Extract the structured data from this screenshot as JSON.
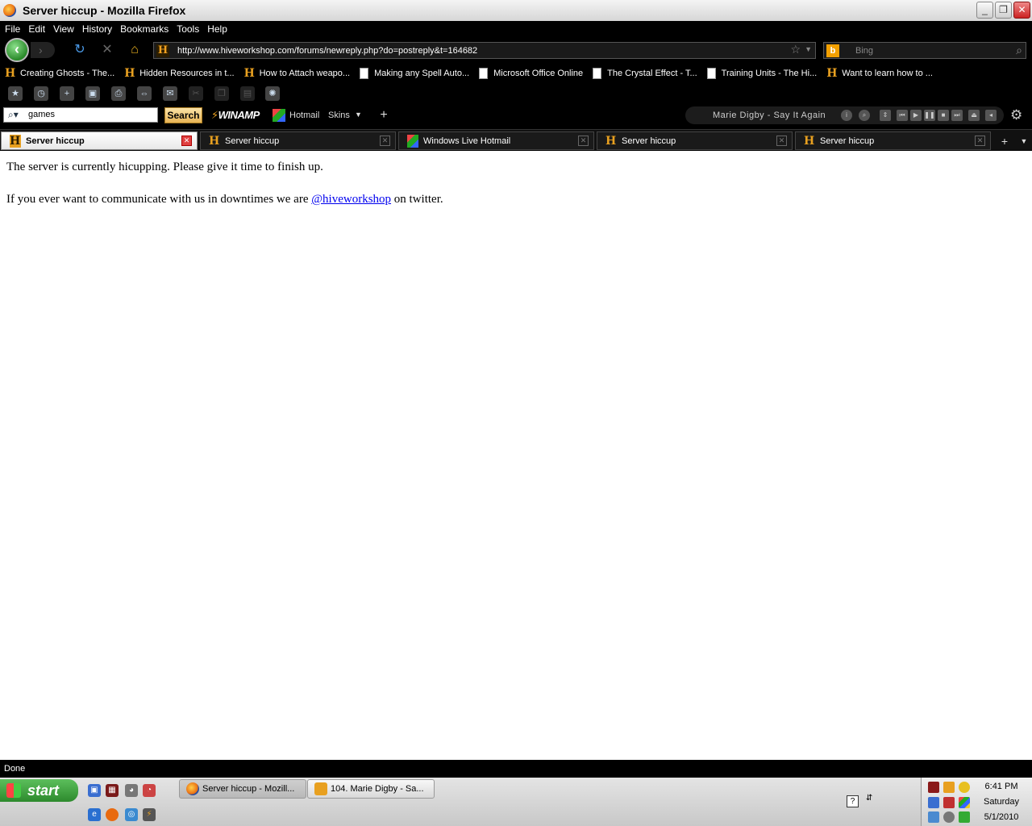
{
  "window": {
    "title": "Server hiccup - Mozilla Firefox",
    "buttons": [
      "minimize",
      "restore",
      "close"
    ]
  },
  "menu": [
    "File",
    "Edit",
    "View",
    "History",
    "Bookmarks",
    "Tools",
    "Help"
  ],
  "nav": {
    "url": "http://www.hiveworkshop.com/forums/newreply.php?do=postreply&t=164682",
    "search_placeholder": "Bing"
  },
  "bookmarks": [
    {
      "label": "Creating Ghosts - The...",
      "icon": "hive-icon"
    },
    {
      "label": "Hidden Resources in t...",
      "icon": "hive-icon"
    },
    {
      "label": "How to Attach weapo...",
      "icon": "hive-icon"
    },
    {
      "label": "Making any Spell Auto...",
      "icon": "page-icon"
    },
    {
      "label": "Microsoft Office Online",
      "icon": "page-icon"
    },
    {
      "label": "The Crystal Effect - T...",
      "icon": "page-icon"
    },
    {
      "label": "Training Units - The Hi...",
      "icon": "page-icon"
    },
    {
      "label": "Want to learn how to ...",
      "icon": "hive-icon"
    }
  ],
  "winamp": {
    "search_value": "games",
    "search_button": "Search",
    "logo": "WINAMP",
    "hotmail": "Hotmail",
    "skins": "Skins",
    "now_playing": "Marie Digby - Say It Again"
  },
  "tabs": [
    {
      "label": "Server hiccup",
      "active": true
    },
    {
      "label": "Server hiccup",
      "active": false
    },
    {
      "label": "Windows Live Hotmail",
      "active": false
    },
    {
      "label": "Server hiccup",
      "active": false
    },
    {
      "label": "Server hiccup",
      "active": false
    }
  ],
  "content": {
    "line1": "The server is currently hicupping. Please give it time to finish up.",
    "line2_before": "If you ever want to communicate with us in downtimes we are ",
    "line2_link": "@hiveworkshop",
    "line2_after": " on twitter."
  },
  "status": "Done",
  "taskbar": {
    "start": "start",
    "tasks": [
      {
        "label": "Server hiccup - Mozill...",
        "active": true
      },
      {
        "label": "104. Marie Digby - Sa...",
        "active": false
      }
    ],
    "clock": {
      "time": "6:41 PM",
      "day": "Saturday",
      "date": "5/1/2010"
    }
  }
}
